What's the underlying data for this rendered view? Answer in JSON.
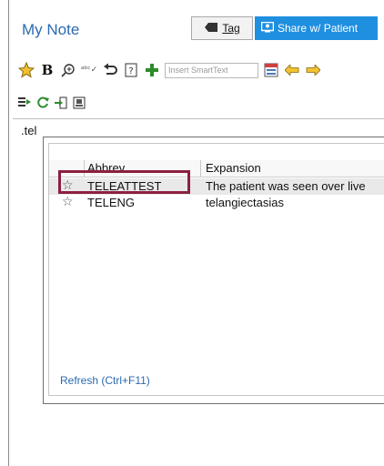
{
  "header": {
    "title": "My Note",
    "tag_label": "Tag",
    "share_label": "Share w/ Patient"
  },
  "toolbar": {
    "smarttext_placeholder": "Insert SmartText",
    "icons": [
      "favorite-star-icon",
      "bold-icon",
      "find-icon",
      "spellcheck-icon",
      "undo-icon",
      "smartphrase-icon",
      "add-icon",
      "smarttext-input",
      "smartlist-icon",
      "prev-arrow-icon",
      "next-arrow-icon"
    ],
    "icons2": [
      "insert-list-icon",
      "refresh-icon",
      "import-icon",
      "template-icon"
    ]
  },
  "editor": {
    "typed_text": ".tel"
  },
  "autocomplete": {
    "columns": [
      "Abbrev",
      "Expansion"
    ],
    "rows": [
      {
        "abbrev": "TELEATTEST",
        "expansion": "The patient was seen over live",
        "selected": true
      },
      {
        "abbrev": "TELENG",
        "expansion": "telangiectasias",
        "selected": false
      }
    ],
    "refresh_label": "Refresh (Ctrl+F11)"
  },
  "colors": {
    "accent": "#2a6ab0",
    "share_bg": "#1f8fe0",
    "highlight": "#8b2040"
  }
}
